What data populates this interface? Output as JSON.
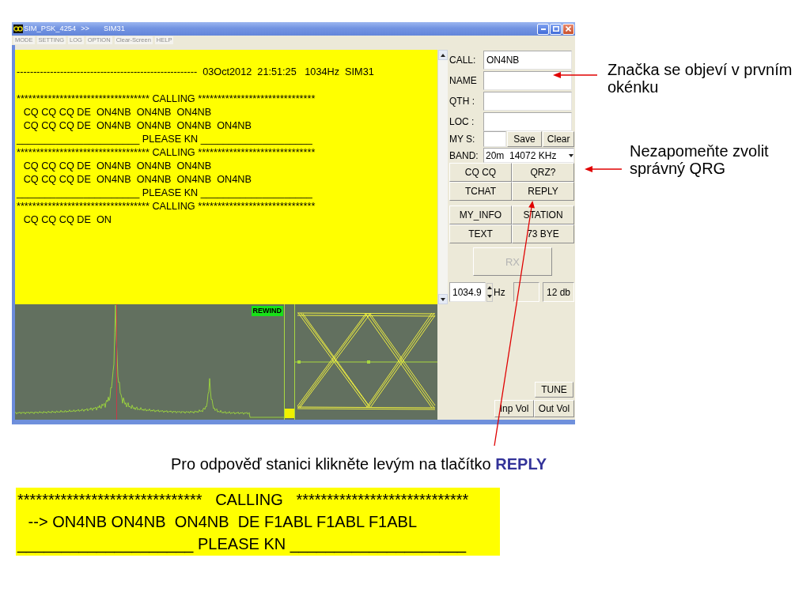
{
  "window": {
    "title": "SIM_PSK_4254",
    "title_extras": [
      ">>",
      "SIM31"
    ]
  },
  "menu": [
    "MODE",
    "SETTING",
    "LOG",
    "OPTION",
    "Clear-Screen",
    "HELP"
  ],
  "receive_log": {
    "lines": [
      {
        "kind": "header",
        "text": "------------------------------------------------------  03Oct2012  21:51:25   1034Hz  SIM31"
      },
      {
        "kind": "banner",
        "text": "********************************** CALLING ******************************"
      },
      {
        "kind": "text",
        "text": "CQ CQ CQ DE  ON4NB  ON4NB  ON4NB"
      },
      {
        "kind": "text",
        "text": "CQ CQ CQ DE  ON4NB  ON4NB  ON4NB  ON4NB"
      },
      {
        "kind": "rule",
        "text": "______________________ PLEASE KN ____________________"
      },
      {
        "kind": "banner",
        "text": "********************************** CALLING ******************************"
      },
      {
        "kind": "text",
        "text": "CQ CQ CQ DE  ON4NB  ON4NB  ON4NB"
      },
      {
        "kind": "text",
        "text": "CQ CQ CQ DE  ON4NB  ON4NB  ON4NB  ON4NB"
      },
      {
        "kind": "rule",
        "text": "______________________ PLEASE KN ____________________"
      },
      {
        "kind": "banner",
        "text": "********************************** CALLING ******************************"
      },
      {
        "kind": "text",
        "text": "CQ CQ CQ DE  ON"
      }
    ]
  },
  "spectrum": {
    "badge": "REWIND"
  },
  "station_fields": [
    {
      "label": "CALL:",
      "value": "ON4NB"
    },
    {
      "label": "NAME"
    },
    {
      "label": "QTH :"
    },
    {
      "label": "LOC :"
    }
  ],
  "my_s": {
    "label": "MY S:",
    "buttons": [
      "Save",
      "Clear"
    ]
  },
  "band": {
    "label": "BAND:",
    "value": "20m  14072 KHz"
  },
  "macro_buttons": [
    "CQ CQ",
    "QRZ?",
    "TCHAT",
    "REPLY"
  ],
  "info_buttons": [
    "MY_INFO",
    "STATION",
    "TEXT",
    "73 BYE"
  ],
  "rx_button": {
    "label": "RX",
    "disabled": true
  },
  "frequency": {
    "value": "1034.9",
    "unit": "Hz",
    "signal": "12 db"
  },
  "tune_button": "TUNE",
  "volume_buttons": [
    "Inp Vol",
    "Out Vol"
  ],
  "annotations": [
    "Značka se objeví v prvním okénku",
    "Nezapomeňte zvolit správný QRG"
  ],
  "caption": "Pro odpověď stanici klikněte levým na tlačítko **REPLY**",
  "example_log": {
    "lines": [
      {
        "kind": "banner",
        "text": "******************************   CALLING   ****************************"
      },
      {
        "kind": "text",
        "text": "--> ON4NB ON4NB  ON4NB  DE F1ABL F1ABL F1ABL"
      },
      {
        "kind": "rule",
        "text": "____________________ PLEASE KN ____________________"
      }
    ]
  }
}
